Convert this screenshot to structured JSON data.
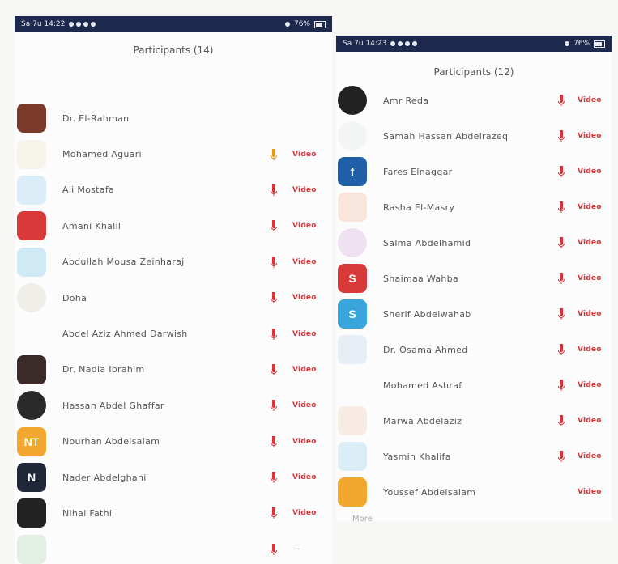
{
  "left": {
    "status_time": "Sa 7u 14:22",
    "status_right": "76%",
    "title": "Participants (14)",
    "participants": [
      {
        "name": "Dr. El-Rahman",
        "avatar_color": "#7a3a2a",
        "avatar_text": "",
        "avatar_shape": "square",
        "mic": "none",
        "video_label": "",
        "video_color": "gray"
      },
      {
        "name": "Mohamed Aguari",
        "avatar_color": "#f6f3ea",
        "avatar_text": "",
        "avatar_shape": "square",
        "mic": "orange",
        "video_label": "Video",
        "video_color": "red"
      },
      {
        "name": "Ali Mostafa",
        "avatar_color": "#dbeef8",
        "avatar_text": "",
        "avatar_shape": "square",
        "mic": "muted",
        "video_label": "Video",
        "video_color": "red"
      },
      {
        "name": "Amani Khalil",
        "avatar_color": "#d83a3a",
        "avatar_text": "",
        "avatar_shape": "square",
        "mic": "muted",
        "video_label": "Video",
        "video_color": "red"
      },
      {
        "name": "Abdullah Mousa Zeinharaj",
        "avatar_color": "#cfe9f5",
        "avatar_text": "",
        "avatar_shape": "square",
        "mic": "muted",
        "video_label": "Video",
        "video_color": "red"
      },
      {
        "name": "Doha",
        "avatar_color": "#efeee8",
        "avatar_text": "",
        "avatar_shape": "round",
        "mic": "muted",
        "video_label": "Video",
        "video_color": "red"
      },
      {
        "name": "Abdel Aziz Ahmed Darwish",
        "avatar_color": "",
        "avatar_text": "",
        "avatar_shape": "blank",
        "mic": "muted",
        "video_label": "Video",
        "video_color": "red"
      },
      {
        "name": "Dr. Nadia Ibrahim",
        "avatar_color": "#3a2a2a",
        "avatar_text": "",
        "avatar_shape": "square",
        "mic": "muted",
        "video_label": "Video",
        "video_color": "red"
      },
      {
        "name": "Hassan Abdel Ghaffar",
        "avatar_color": "#2a2a2a",
        "avatar_text": "",
        "avatar_shape": "round",
        "mic": "muted",
        "video_label": "Video",
        "video_color": "red"
      },
      {
        "name": "Nourhan Abdelsalam",
        "avatar_color": "#f2a72e",
        "avatar_text": "NT",
        "avatar_shape": "square",
        "mic": "muted",
        "video_label": "Video",
        "video_color": "red"
      },
      {
        "name": "Nader Abdelghani",
        "avatar_color": "#1f2738",
        "avatar_text": "N",
        "avatar_shape": "square",
        "mic": "muted",
        "video_label": "Video",
        "video_color": "red"
      },
      {
        "name": "Nihal Fathi",
        "avatar_color": "#222222",
        "avatar_text": "",
        "avatar_shape": "square",
        "mic": "muted",
        "video_label": "Video",
        "video_color": "red"
      },
      {
        "name": "",
        "avatar_color": "#e4efe4",
        "avatar_text": "",
        "avatar_shape": "blank",
        "mic": "muted",
        "video_label": "—",
        "video_color": "gray"
      }
    ]
  },
  "right": {
    "status_time": "Sa 7u 14:23",
    "status_right": "76%",
    "title": "Participants (12)",
    "participants": [
      {
        "name": "Amr Reda",
        "avatar_color": "#222222",
        "avatar_text": "",
        "avatar_shape": "round",
        "mic": "muted",
        "video_label": "Video",
        "video_color": "red"
      },
      {
        "name": "Samah Hassan Abdelrazeq",
        "avatar_color": "#f3f5f5",
        "avatar_text": "",
        "avatar_shape": "round",
        "mic": "muted",
        "video_label": "Video",
        "video_color": "red"
      },
      {
        "name": "Fares Elnaggar",
        "avatar_color": "#1f5fa8",
        "avatar_text": "f",
        "avatar_shape": "square",
        "mic": "muted",
        "video_label": "Video",
        "video_color": "red"
      },
      {
        "name": "Rasha El-Masry",
        "avatar_color": "#f8e6dc",
        "avatar_text": "",
        "avatar_shape": "square",
        "mic": "muted",
        "video_label": "Video",
        "video_color": "red"
      },
      {
        "name": "Salma Abdelhamid",
        "avatar_color": "#efe1f2",
        "avatar_text": "",
        "avatar_shape": "round",
        "mic": "muted",
        "video_label": "Video",
        "video_color": "red"
      },
      {
        "name": "Shaimaa Wahba",
        "avatar_color": "#d83a3a",
        "avatar_text": "S",
        "avatar_shape": "square",
        "mic": "muted",
        "video_label": "Video",
        "video_color": "red"
      },
      {
        "name": "Sherif Abdelwahab",
        "avatar_color": "#3aa5dc",
        "avatar_text": "S",
        "avatar_shape": "square",
        "mic": "muted",
        "video_label": "Video",
        "video_color": "red"
      },
      {
        "name": "Dr. Osama Ahmed",
        "avatar_color": "#e8eef5",
        "avatar_text": "",
        "avatar_shape": "square",
        "mic": "muted",
        "video_label": "Video",
        "video_color": "red"
      },
      {
        "name": "Mohamed Ashraf",
        "avatar_color": "",
        "avatar_text": "",
        "avatar_shape": "blank",
        "mic": "muted",
        "video_label": "Video",
        "video_color": "red"
      },
      {
        "name": "Marwa Abdelaziz",
        "avatar_color": "#f8ebe4",
        "avatar_text": "",
        "avatar_shape": "square",
        "mic": "muted",
        "video_label": "Video",
        "video_color": "red"
      },
      {
        "name": "Yasmin Khalifa",
        "avatar_color": "#dbeef8",
        "avatar_text": "",
        "avatar_shape": "square",
        "mic": "muted",
        "video_label": "Video",
        "video_color": "red"
      },
      {
        "name": "Youssef Abdelsalam",
        "avatar_color": "#f2a72e",
        "avatar_text": "",
        "avatar_shape": "square",
        "mic": "none",
        "video_label": "Video",
        "video_color": "red"
      }
    ],
    "more_label": "More"
  }
}
